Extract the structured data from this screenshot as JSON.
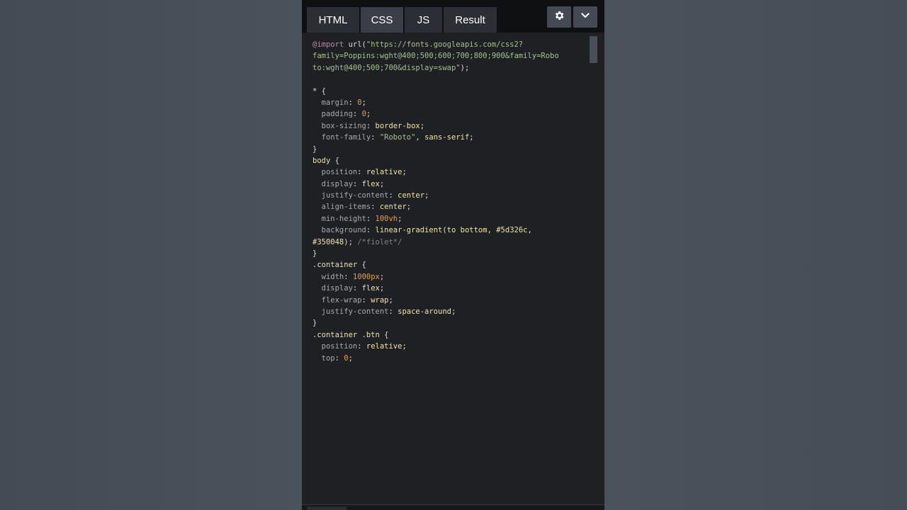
{
  "tabs": [
    {
      "label": "HTML",
      "active": false
    },
    {
      "label": "CSS",
      "active": true
    },
    {
      "label": "JS",
      "active": false
    },
    {
      "label": "Result",
      "active": false
    }
  ],
  "toolbar": {
    "settings_icon": "gear-icon",
    "collapse_icon": "chevron-down-icon"
  },
  "editor": {
    "language": "CSS",
    "lines": [
      [
        {
          "t": "atrule",
          "v": "@import"
        },
        {
          "t": "punct",
          "v": " url("
        },
        {
          "t": "str",
          "v": "\"https://fonts.googleapis.com/css2?"
        }
      ],
      [
        {
          "t": "str",
          "v": "family=Poppins:wght@400;500;600;700;800;900&family=Robo"
        }
      ],
      [
        {
          "t": "str",
          "v": "to:wght@400;500;700&display=swap\""
        },
        {
          "t": "punct",
          "v": ");"
        }
      ],
      [],
      [
        {
          "t": "selector",
          "v": "*"
        },
        {
          "t": "punct",
          "v": " {"
        }
      ],
      [
        {
          "t": "prop",
          "v": "  margin"
        },
        {
          "t": "punct",
          "v": ": "
        },
        {
          "t": "num",
          "v": "0"
        },
        {
          "t": "punct",
          "v": ";"
        }
      ],
      [
        {
          "t": "prop",
          "v": "  padding"
        },
        {
          "t": "punct",
          "v": ": "
        },
        {
          "t": "num",
          "v": "0"
        },
        {
          "t": "punct",
          "v": ";"
        }
      ],
      [
        {
          "t": "prop",
          "v": "  box-sizing"
        },
        {
          "t": "punct",
          "v": ": "
        },
        {
          "t": "kw",
          "v": "border-box"
        },
        {
          "t": "punct",
          "v": ";"
        }
      ],
      [
        {
          "t": "prop",
          "v": "  font-family"
        },
        {
          "t": "punct",
          "v": ": "
        },
        {
          "t": "str",
          "v": "\"Roboto\""
        },
        {
          "t": "punct",
          "v": ", "
        },
        {
          "t": "kw",
          "v": "sans-serif"
        },
        {
          "t": "punct",
          "v": ";"
        }
      ],
      [
        {
          "t": "punct",
          "v": "}"
        }
      ],
      [
        {
          "t": "selector",
          "v": "body"
        },
        {
          "t": "punct",
          "v": " {"
        }
      ],
      [
        {
          "t": "prop",
          "v": "  position"
        },
        {
          "t": "punct",
          "v": ": "
        },
        {
          "t": "kw",
          "v": "relative"
        },
        {
          "t": "punct",
          "v": ";"
        }
      ],
      [
        {
          "t": "prop",
          "v": "  display"
        },
        {
          "t": "punct",
          "v": ": "
        },
        {
          "t": "kw",
          "v": "flex"
        },
        {
          "t": "punct",
          "v": ";"
        }
      ],
      [
        {
          "t": "prop",
          "v": "  justify-content"
        },
        {
          "t": "punct",
          "v": ": "
        },
        {
          "t": "kw",
          "v": "center"
        },
        {
          "t": "punct",
          "v": ";"
        }
      ],
      [
        {
          "t": "prop",
          "v": "  align-items"
        },
        {
          "t": "punct",
          "v": ": "
        },
        {
          "t": "kw",
          "v": "center"
        },
        {
          "t": "punct",
          "v": ";"
        }
      ],
      [
        {
          "t": "prop",
          "v": "  min-height"
        },
        {
          "t": "punct",
          "v": ": "
        },
        {
          "t": "num",
          "v": "100vh"
        },
        {
          "t": "punct",
          "v": ";"
        }
      ],
      [
        {
          "t": "prop",
          "v": "  background"
        },
        {
          "t": "punct",
          "v": ": "
        },
        {
          "t": "kw",
          "v": "linear-gradient"
        },
        {
          "t": "punct",
          "v": "("
        },
        {
          "t": "kw",
          "v": "to bottom"
        },
        {
          "t": "punct",
          "v": ", "
        },
        {
          "t": "kw",
          "v": "#5d326c"
        },
        {
          "t": "punct",
          "v": ","
        }
      ],
      [
        {
          "t": "kw",
          "v": "#350048"
        },
        {
          "t": "punct",
          "v": "); "
        },
        {
          "t": "comment",
          "v": "/*fiolet*/"
        }
      ],
      [
        {
          "t": "punct",
          "v": "}"
        }
      ],
      [
        {
          "t": "selector",
          "v": ".container"
        },
        {
          "t": "punct",
          "v": " {"
        }
      ],
      [
        {
          "t": "prop",
          "v": "  width"
        },
        {
          "t": "punct",
          "v": ": "
        },
        {
          "t": "num",
          "v": "1000px"
        },
        {
          "t": "punct",
          "v": ";"
        }
      ],
      [
        {
          "t": "prop",
          "v": "  display"
        },
        {
          "t": "punct",
          "v": ": "
        },
        {
          "t": "kw",
          "v": "flex"
        },
        {
          "t": "punct",
          "v": ";"
        }
      ],
      [
        {
          "t": "prop",
          "v": "  flex-wrap"
        },
        {
          "t": "punct",
          "v": ": "
        },
        {
          "t": "kw",
          "v": "wrap"
        },
        {
          "t": "punct",
          "v": ";"
        }
      ],
      [
        {
          "t": "prop",
          "v": "  justify-content"
        },
        {
          "t": "punct",
          "v": ": "
        },
        {
          "t": "kw",
          "v": "space-around"
        },
        {
          "t": "punct",
          "v": ";"
        }
      ],
      [
        {
          "t": "punct",
          "v": "}"
        }
      ],
      [
        {
          "t": "selector",
          "v": ".container .btn"
        },
        {
          "t": "punct",
          "v": " {"
        }
      ],
      [
        {
          "t": "prop",
          "v": "  position"
        },
        {
          "t": "punct",
          "v": ": "
        },
        {
          "t": "kw",
          "v": "relative"
        },
        {
          "t": "punct",
          "v": ";"
        }
      ],
      [
        {
          "t": "prop",
          "v": "  top"
        },
        {
          "t": "punct",
          "v": ": "
        },
        {
          "t": "num",
          "v": "0"
        },
        {
          "t": "punct",
          "v": ";"
        }
      ]
    ]
  },
  "colors": {
    "page_background": "#4b535c",
    "editor_background": "#1e2023",
    "tab_active": "#3a3f47",
    "tab_inactive": "#2b2f35",
    "number": "#e89c4b",
    "string": "#a7c18d",
    "keyword": "#f0e4a8",
    "comment": "#7c818a"
  }
}
